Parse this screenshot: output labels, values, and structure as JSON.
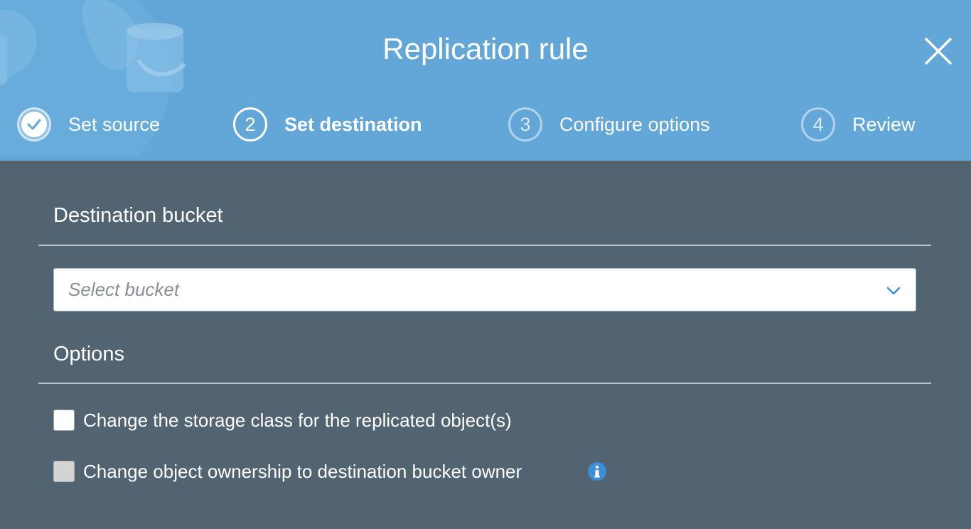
{
  "header": {
    "title": "Replication rule",
    "steps": [
      {
        "number": "1",
        "label": "Set source",
        "state": "done"
      },
      {
        "number": "2",
        "label": "Set destination",
        "state": "active"
      },
      {
        "number": "3",
        "label": "Configure options",
        "state": "pending"
      },
      {
        "number": "4",
        "label": "Review",
        "state": "pending"
      }
    ]
  },
  "destination": {
    "section_title": "Destination bucket",
    "select_placeholder": "Select bucket"
  },
  "options": {
    "section_title": "Options",
    "items": [
      {
        "label": "Change the storage class for the replicated object(s)",
        "checked": false,
        "enabled": true
      },
      {
        "label": "Change object ownership to destination bucket owner",
        "checked": false,
        "enabled": false
      }
    ]
  },
  "icons": {
    "close": "close-icon",
    "check": "checkmark-icon",
    "chevron": "chevron-down-icon",
    "info": "info-icon"
  },
  "colors": {
    "header_bg": "#63a7d8",
    "body_bg": "#526371",
    "accent": "#3b8fd6"
  }
}
